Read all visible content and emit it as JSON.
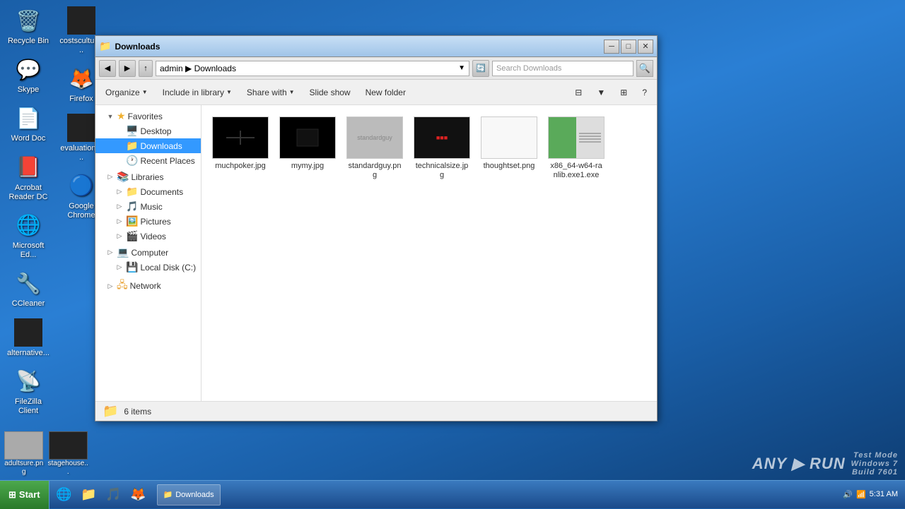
{
  "desktop": {
    "background": "#1a5fa8",
    "icons": [
      {
        "id": "recycle-bin",
        "label": "Recycle Bin",
        "icon": "🗑️"
      },
      {
        "id": "skype",
        "label": "Skype",
        "icon": "💬"
      },
      {
        "id": "word",
        "label": "Word Doc",
        "icon": "📄"
      },
      {
        "id": "acrobat",
        "label": "Acrobat Reader DC",
        "icon": "📕"
      },
      {
        "id": "microsoft-edge",
        "label": "Microsoft Ed...",
        "icon": "🌐"
      },
      {
        "id": "ccleaner",
        "label": "CCleaner",
        "icon": "🔧"
      },
      {
        "id": "alternative",
        "label": "alternative...",
        "icon": "⬛"
      },
      {
        "id": "filezilla",
        "label": "FileZilla Client",
        "icon": "📡"
      },
      {
        "id": "costsculturs",
        "label": "costsculturs...",
        "icon": "⬛"
      },
      {
        "id": "firefox",
        "label": "Firefox",
        "icon": "🦊"
      },
      {
        "id": "evaluation",
        "label": "evaluationg...",
        "icon": "⬛"
      },
      {
        "id": "chrome",
        "label": "Google Chrome",
        "icon": "🔵"
      }
    ],
    "bottom_icons": [
      {
        "id": "adultsure",
        "label": "adultsure.png",
        "icon": "🖼️"
      },
      {
        "id": "stagehouse",
        "label": "stagehouse...",
        "icon": "⬛"
      }
    ]
  },
  "window": {
    "title": "Downloads",
    "title_icon": "📁",
    "address": {
      "path": "admin  ▶  Downloads",
      "search_placeholder": "Search Downloads"
    },
    "toolbar": {
      "organize_label": "Organize",
      "include_library_label": "Include in library",
      "share_with_label": "Share with",
      "slide_show_label": "Slide show",
      "new_folder_label": "New folder"
    },
    "nav_tree": {
      "favorites": {
        "label": "Favorites",
        "items": [
          {
            "label": "Desktop",
            "icon": "🖥️"
          },
          {
            "label": "Downloads",
            "icon": "📁",
            "selected": true
          },
          {
            "label": "Recent Places",
            "icon": "🕐"
          }
        ]
      },
      "libraries": {
        "label": "Libraries",
        "items": [
          {
            "label": "Documents",
            "icon": "📁"
          },
          {
            "label": "Music",
            "icon": "🎵"
          },
          {
            "label": "Pictures",
            "icon": "🖼️"
          },
          {
            "label": "Videos",
            "icon": "🎬"
          }
        ]
      },
      "computer": {
        "label": "Computer",
        "items": [
          {
            "label": "Local Disk (C:)",
            "icon": "💾"
          }
        ]
      },
      "network": {
        "label": "Network",
        "items": []
      }
    },
    "files": [
      {
        "name": "muchpoker.jpg",
        "thumb_type": "black"
      },
      {
        "name": "mymy.jpg",
        "thumb_type": "black"
      },
      {
        "name": "standardguy.png",
        "thumb_type": "grey"
      },
      {
        "name": "technicalsize.jpg",
        "thumb_type": "dark-red"
      },
      {
        "name": "thoughtset.png",
        "thumb_type": "white"
      },
      {
        "name": "x86_64-w64-ranlib.exe1.exe",
        "thumb_type": "exe"
      }
    ],
    "status": {
      "item_count": "6 items",
      "icon": "📁"
    }
  },
  "taskbar": {
    "start_label": "Start",
    "time": "5:31 AM",
    "windows_build": "Windows 7\nBuild 7601",
    "test_mode": "Test Mode",
    "taskbar_items": [
      {
        "label": "IE",
        "icon": "🌐"
      },
      {
        "label": "Explorer",
        "icon": "📁"
      },
      {
        "label": "Media",
        "icon": "🎵"
      },
      {
        "label": "Firefox",
        "icon": "🦊"
      }
    ],
    "open_windows": [
      {
        "label": "Downloads",
        "icon": "📁"
      }
    ]
  },
  "watermark": {
    "logo": "ANY ▶ RUN",
    "mode": "Test Mode",
    "os": "Windows 7",
    "build": "Build 7601"
  }
}
